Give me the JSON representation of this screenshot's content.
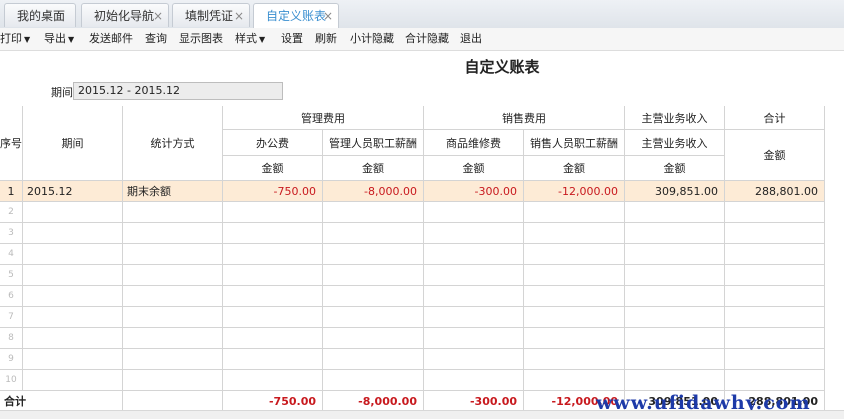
{
  "tabs": [
    "我的桌面",
    "初始化导航",
    "填制凭证",
    "自定义账表"
  ],
  "tab_close_glyph": "×",
  "toolbar": {
    "print": "打印",
    "export": "导出",
    "send_mail": "发送邮件",
    "query": "查询",
    "show_chart": "显示图表",
    "style": "样式",
    "settings": "设置",
    "refresh": "刷新",
    "subtotal_hide": "小计隐藏",
    "total_hide": "合计隐藏",
    "exit": "退出"
  },
  "report": {
    "title": "自定义账表",
    "period_label": "期间",
    "period_value": "2015.12 - 2015.12"
  },
  "headers": {
    "seq": "序号",
    "period": "期间",
    "method": "统计方式",
    "group_mgmt": "管理费用",
    "group_sales": "销售费用",
    "group_main": "主营业务收入",
    "group_total": "合计",
    "office": "办公费",
    "mgmt_salary": "管理人员职工薪酬",
    "goods_repair": "商品维修费",
    "sales_salary": "销售人员职工薪酬",
    "main_income": "主营业务收入",
    "amount": "金额"
  },
  "rows": [
    {
      "seq": "1",
      "period": "2015.12",
      "method": "期末余额",
      "office": "-750.00",
      "mgmt_salary": "-8,000.00",
      "goods_repair": "-300.00",
      "sales_salary": "-12,000.00",
      "main_income": "309,851.00",
      "total": "288,801.00"
    }
  ],
  "empty_row_numbers": [
    "2",
    "3",
    "4",
    "5",
    "6",
    "7",
    "8",
    "9",
    "10"
  ],
  "totals": {
    "label": "合计",
    "office": "-750.00",
    "mgmt_salary": "-8,000.00",
    "goods_repair": "-300.00",
    "sales_salary": "-12,000.00",
    "main_income": "309,851.00",
    "total": "288,801.00"
  },
  "watermark": "www.ufidawhy.com",
  "colors": {
    "accent": "#3b8fd0",
    "negative": "#c8191e",
    "highlight_row": "#fdebd6",
    "watermark": "#1d3aa8"
  }
}
